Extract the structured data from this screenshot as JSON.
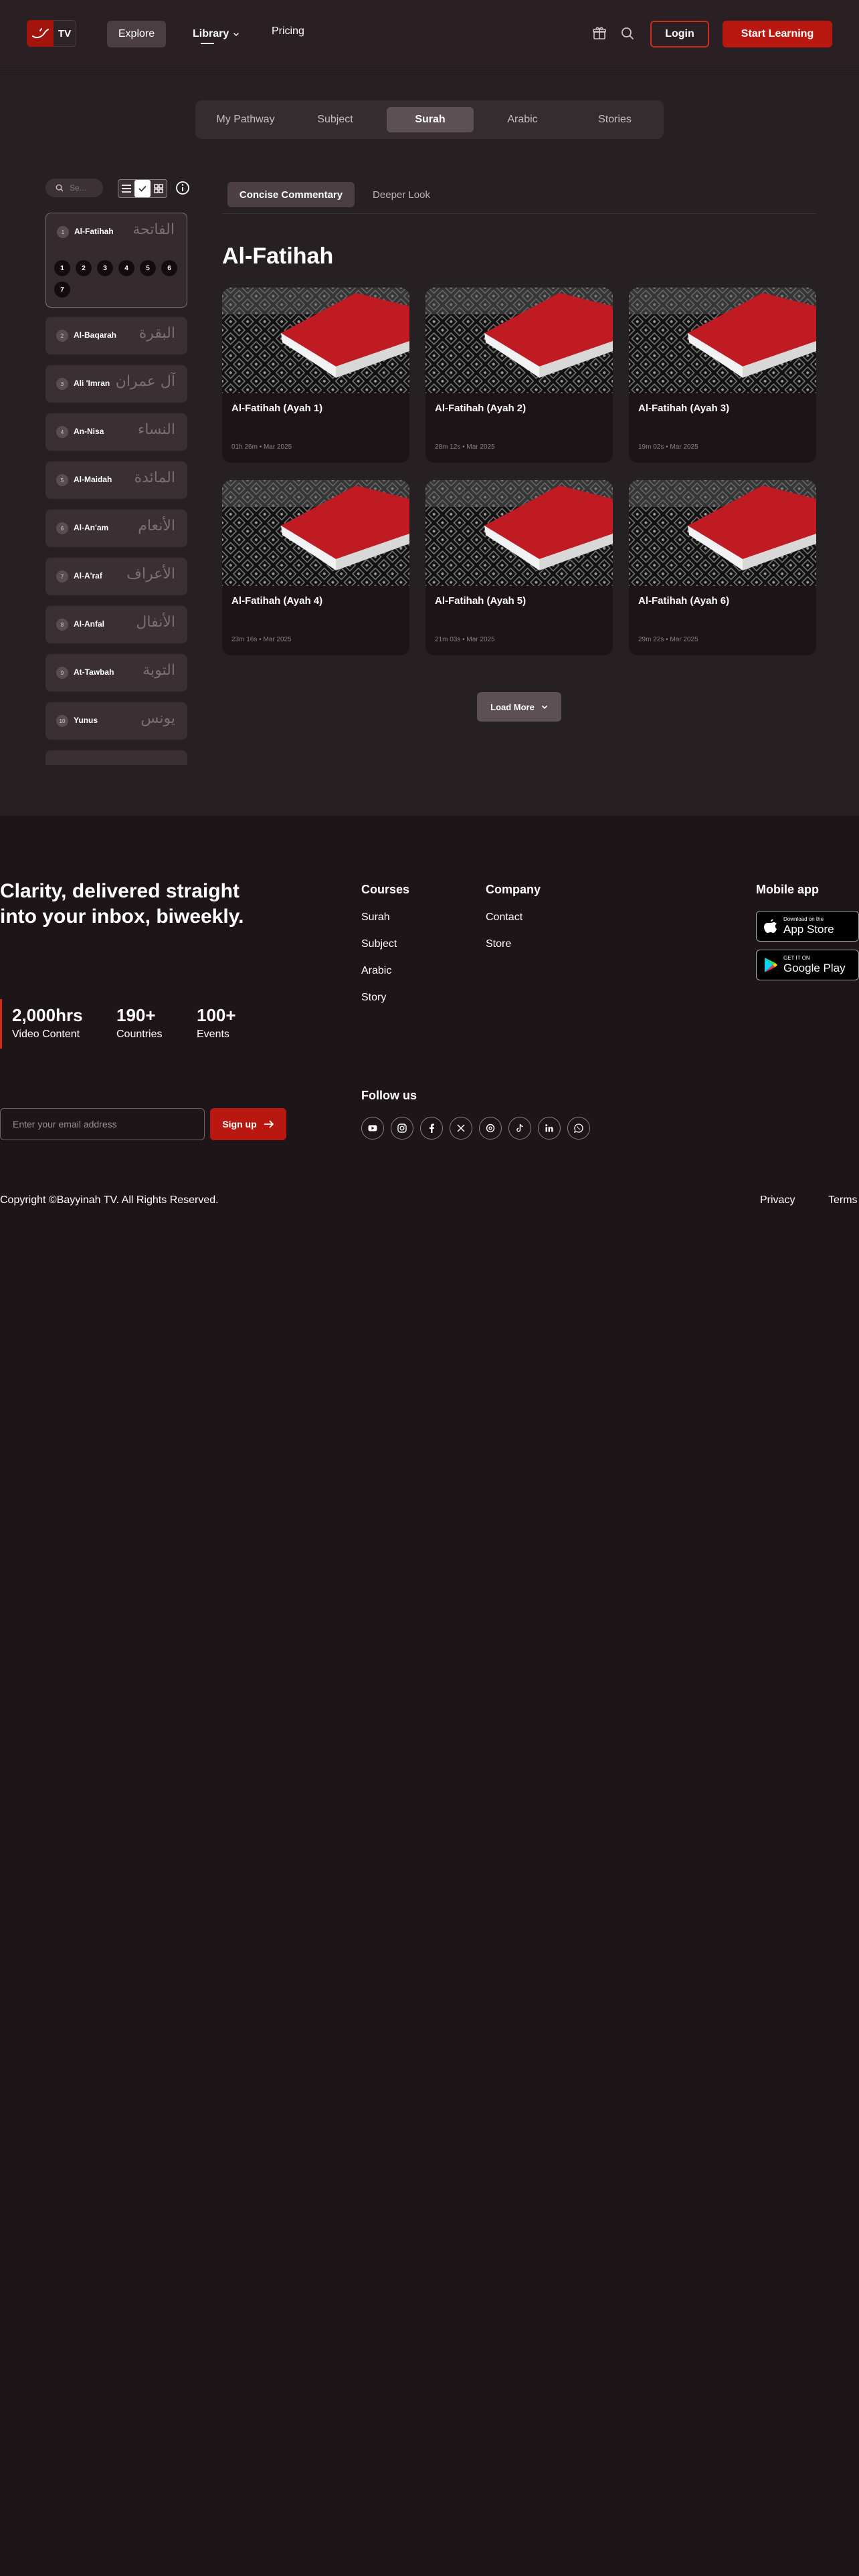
{
  "header": {
    "logo_text": "TV",
    "nav": {
      "explore": "Explore",
      "library": "Library",
      "pricing": "Pricing"
    },
    "icons": [
      "gift-icon",
      "search-icon"
    ],
    "login": "Login",
    "start_learning": "Start Learning",
    "colors": {
      "accent": "#b8180f",
      "accent_border": "#d5291b"
    }
  },
  "tabs": [
    {
      "label": "My Pathway",
      "active": false
    },
    {
      "label": "Subject",
      "active": false
    },
    {
      "label": "Surah",
      "active": true
    },
    {
      "label": "Arabic",
      "active": false
    },
    {
      "label": "Stories",
      "active": false
    }
  ],
  "sidebar": {
    "search_placeholder": "Se...",
    "view_modes": [
      "list-view",
      "check-view",
      "grid-view"
    ],
    "active_view": "check-view",
    "surahs": [
      {
        "num": "1",
        "name": "Al-Fatihah",
        "arabic": "الفاتحة",
        "expanded": true,
        "ayahs": [
          "1",
          "2",
          "3",
          "4",
          "5",
          "6",
          "7"
        ]
      },
      {
        "num": "2",
        "name": "Al-Baqarah",
        "arabic": "البقرة"
      },
      {
        "num": "3",
        "name": "Ali 'Imran",
        "arabic": "آل عمران"
      },
      {
        "num": "4",
        "name": "An-Nisa",
        "arabic": "النساء"
      },
      {
        "num": "5",
        "name": "Al-Maidah",
        "arabic": "المائدة"
      },
      {
        "num": "6",
        "name": "Al-An'am",
        "arabic": "الأنعام"
      },
      {
        "num": "7",
        "name": "Al-A'raf",
        "arabic": "الأعراف"
      },
      {
        "num": "8",
        "name": "Al-Anfal",
        "arabic": "الأنفال"
      },
      {
        "num": "9",
        "name": "At-Tawbah",
        "arabic": "التوبة"
      },
      {
        "num": "10",
        "name": "Yunus",
        "arabic": "يونس"
      }
    ]
  },
  "content": {
    "sub_tabs": [
      {
        "label": "Concise Commentary",
        "active": true
      },
      {
        "label": "Deeper Look",
        "active": false
      }
    ],
    "title": "Al-Fatihah",
    "cards": [
      {
        "title": "Al-Fatihah (Ayah 1)",
        "meta": "01h 26m • Mar 2025"
      },
      {
        "title": "Al-Fatihah (Ayah 2)",
        "meta": "28m 12s • Mar 2025"
      },
      {
        "title": "Al-Fatihah (Ayah 3)",
        "meta": "19m 02s • Mar 2025"
      },
      {
        "title": "Al-Fatihah (Ayah 4)",
        "meta": "23m 16s • Mar 2025"
      },
      {
        "title": "Al-Fatihah (Ayah 5)",
        "meta": "21m 03s • Mar 2025"
      },
      {
        "title": "Al-Fatihah (Ayah 6)",
        "meta": "29m 22s • Mar 2025"
      }
    ],
    "load_more": "Load More"
  },
  "footer": {
    "newsletter_title": "Clarity, delivered straight into your inbox, biweekly.",
    "stats": [
      {
        "value": "2,000hrs",
        "label": "Video Content"
      },
      {
        "value": "190+",
        "label": "Countries"
      },
      {
        "value": "100+",
        "label": "Events"
      }
    ],
    "email_placeholder": "Enter your email address",
    "signup": "Sign up",
    "courses": {
      "title": "Courses",
      "links": [
        "Surah",
        "Subject",
        "Arabic",
        "Story"
      ]
    },
    "company": {
      "title": "Company",
      "links": [
        "Contact",
        "Store"
      ]
    },
    "mobile": {
      "title": "Mobile app",
      "app_store_small": "Download on the",
      "app_store_big": "App Store",
      "play_small": "GET IT ON",
      "play_big": "Google Play"
    },
    "follow_title": "Follow us",
    "socials": [
      "youtube-icon",
      "instagram-icon",
      "facebook-icon",
      "x-icon",
      "threads-icon",
      "tiktok-icon",
      "linkedin-icon",
      "whatsapp-icon"
    ],
    "copyright": "Copyright ©Bayyinah TV. All Rights Reserved.",
    "privacy": "Privacy",
    "terms": "Terms"
  }
}
